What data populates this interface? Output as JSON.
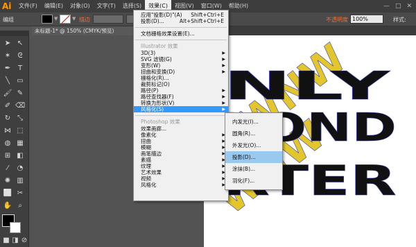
{
  "app": {
    "logo": "Ai"
  },
  "menubar": {
    "items": [
      "文件(F)",
      "编辑(E)",
      "对象(O)",
      "文字(T)",
      "选择(S)",
      "效果(C)",
      "视图(V)",
      "窗口(W)",
      "帮助(H)"
    ],
    "active_index": 5,
    "window_buttons": [
      "—",
      "□",
      "✕"
    ]
  },
  "controlbar": {
    "label": "编组",
    "stroke_label": "描边",
    "opacity_label": "不透明度",
    "opacity_value": "100%",
    "style_label": "样式:"
  },
  "document_tab": {
    "title": "未标题-1* @ 150% (CMYK/预览)"
  },
  "effect_menu": {
    "top_items": [
      {
        "label": "应用\"投影(D)\"(A)",
        "shortcut": "Shift+Ctrl+E"
      },
      {
        "label": "投影(D)...",
        "shortcut": "Alt+Shift+Ctrl+E"
      }
    ],
    "raster_settings": "文档栅格效果设置(E)...",
    "illustrator_header": "Illustrator 效果",
    "illustrator_items": [
      "3D(3)",
      "SVG 滤镜(G)",
      "变形(W)",
      "扭曲和变换(D)",
      "栅格化(R)...",
      "裁剪标记(O)",
      "路径(P)",
      "路径查找器(F)",
      "转换为形状(V)",
      "风格化(S)"
    ],
    "illustrator_submenu_indices": [
      0,
      1,
      2,
      3,
      6,
      7,
      8,
      9
    ],
    "highlighted_index": 9,
    "photoshop_header": "Photoshop 效果",
    "photoshop_items": [
      "效果画廊...",
      "像素化",
      "扭曲",
      "模糊",
      "画笔描边",
      "素描",
      "纹理",
      "艺术效果",
      "视频",
      "风格化"
    ],
    "photoshop_submenu_indices": [
      1,
      2,
      3,
      4,
      5,
      6,
      7,
      8,
      9
    ]
  },
  "stylize_submenu": {
    "items": [
      "内发光(I)...",
      "圆角(R)...",
      "外发光(O)...",
      "投影(D)...",
      "涂抹(B)...",
      "羽化(F)..."
    ],
    "hover_index": 3
  },
  "artwork": {
    "black_lines": [
      "NLY",
      "YOND",
      "RTER"
    ],
    "yellow_text": "WNW",
    "colors": {
      "black_text": "#111111",
      "yellow": "#e3c62b",
      "path_outline": "#3b3fb0"
    }
  },
  "colors": {
    "menubar": "#3d3d3d",
    "menu_bg": "#f0f0f0",
    "menu_highlight": "#3399ff",
    "submenu_hover": "#99c9ef",
    "accent_label": "#ff6b2b"
  }
}
